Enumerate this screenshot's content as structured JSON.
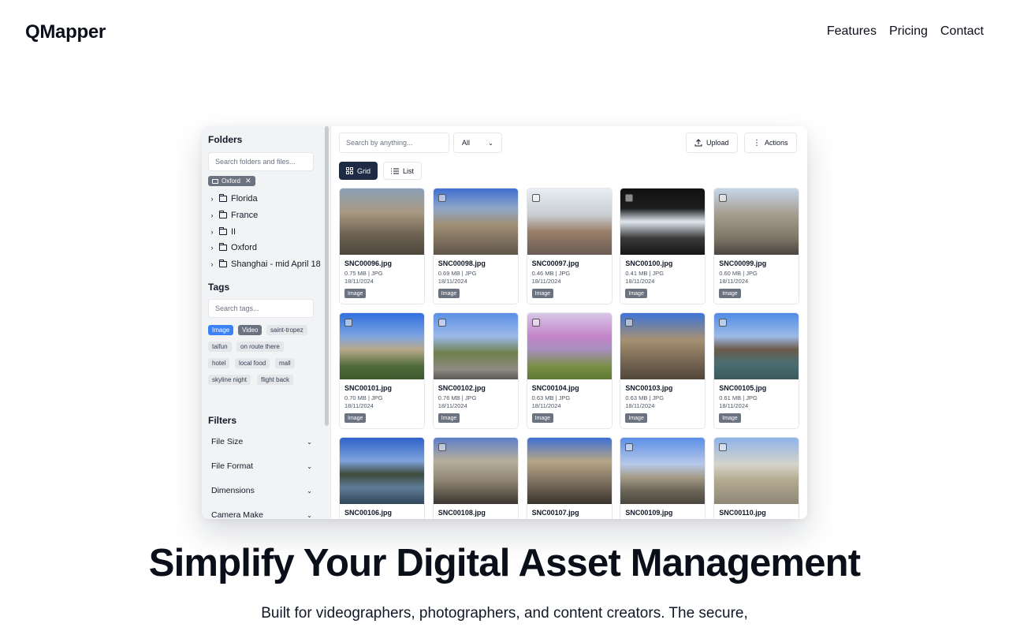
{
  "nav": {
    "brand": "QMapper",
    "links": [
      "Features",
      "Pricing",
      "Contact"
    ]
  },
  "sidebar": {
    "folders_title": "Folders",
    "folders_search_placeholder": "Search folders and files...",
    "selected_folder": "Oxford",
    "folders": [
      "Florida",
      "France",
      "II",
      "Oxford",
      "Shanghai - mid April 18"
    ],
    "tags_title": "Tags",
    "tags_search_placeholder": "Search tags...",
    "tags": [
      "Image",
      "Video",
      "saint-tropez",
      "taifun",
      "on route there",
      "hotel",
      "local food",
      "mall",
      "skyline night",
      "flight back"
    ],
    "filters_title": "Filters",
    "filters": [
      "File Size",
      "File Format",
      "Dimensions",
      "Camera Make"
    ]
  },
  "toolbar": {
    "search_placeholder": "Search by anything...",
    "type_select": "All",
    "upload_label": "Upload",
    "actions_label": "Actions",
    "grid_label": "Grid",
    "list_label": "List"
  },
  "assets": [
    {
      "name": "SNC00096.jpg",
      "meta": "0.75 MB | JPG",
      "date": "18/11/2024",
      "badge": "Image"
    },
    {
      "name": "SNC00098.jpg",
      "meta": "0.69 MB | JPG",
      "date": "18/11/2024",
      "badge": "Image"
    },
    {
      "name": "SNC00097.jpg",
      "meta": "0.46 MB | JPG",
      "date": "18/11/2024",
      "badge": "Image"
    },
    {
      "name": "SNC00100.jpg",
      "meta": "0.41 MB | JPG",
      "date": "18/11/2024",
      "badge": "Image"
    },
    {
      "name": "SNC00099.jpg",
      "meta": "0.60 MB | JPG",
      "date": "18/11/2024",
      "badge": "Image"
    },
    {
      "name": "SNC00101.jpg",
      "meta": "0.70 MB | JPG",
      "date": "18/11/2024",
      "badge": "Image"
    },
    {
      "name": "SNC00102.jpg",
      "meta": "0.76 MB | JPG",
      "date": "18/11/2024",
      "badge": "Image"
    },
    {
      "name": "SNC00104.jpg",
      "meta": "0.63 MB | JPG",
      "date": "18/11/2024",
      "badge": "Image"
    },
    {
      "name": "SNC00103.jpg",
      "meta": "0.63 MB | JPG",
      "date": "18/11/2024",
      "badge": "Image"
    },
    {
      "name": "SNC00105.jpg",
      "meta": "0.61 MB | JPG",
      "date": "18/11/2024",
      "badge": "Image"
    },
    {
      "name": "SNC00106.jpg",
      "meta": "",
      "date": "",
      "badge": ""
    },
    {
      "name": "SNC00108.jpg",
      "meta": "",
      "date": "",
      "badge": ""
    },
    {
      "name": "SNC00107.jpg",
      "meta": "",
      "date": "",
      "badge": ""
    },
    {
      "name": "SNC00109.jpg",
      "meta": "",
      "date": "",
      "badge": ""
    },
    {
      "name": "SNC00110.jpg",
      "meta": "",
      "date": "",
      "badge": ""
    }
  ],
  "hero": {
    "title": "Simplify Your Digital Asset Management",
    "subtitle": "Built for videographers, photographers, and content creators. The secure,"
  },
  "colors": {
    "accent_dark": "#1f2a44",
    "tag_blue": "#3b82f6",
    "badge_gray": "#6b7280"
  }
}
